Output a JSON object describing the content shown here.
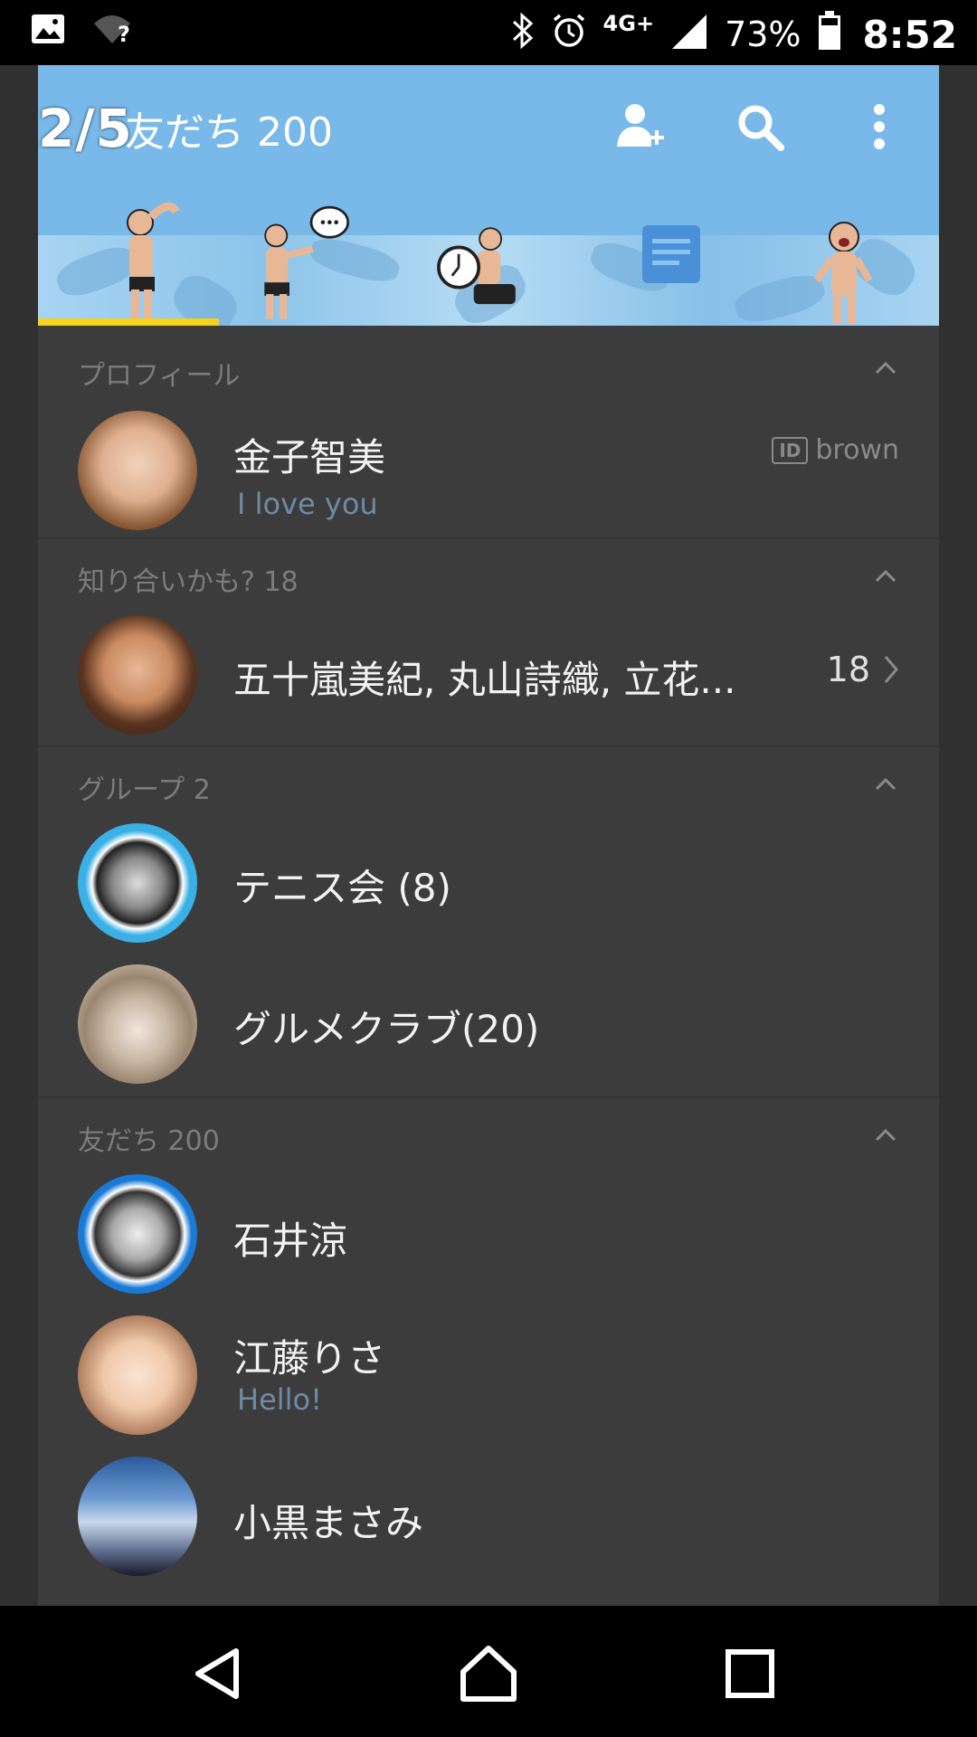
{
  "status_bar": {
    "wifi_label": "?",
    "network": "4G+",
    "battery": "73%",
    "time": "8:52"
  },
  "page_indicator": "2/5",
  "header": {
    "title": "友だち 200",
    "icons": [
      "add-friend-icon",
      "search-icon",
      "more-options-icon"
    ]
  },
  "tabs": [
    {
      "name": "friends-tab",
      "active": true
    },
    {
      "name": "chats-tab",
      "active": false
    },
    {
      "name": "timeline-tab",
      "active": false
    },
    {
      "name": "news-tab",
      "active": false
    },
    {
      "name": "more-tab",
      "active": false
    }
  ],
  "sections": {
    "profile": {
      "header": "プロフィール",
      "name": "金子智美",
      "status": "I love you",
      "id_badge": "ID",
      "id_value": "brown"
    },
    "suggestions": {
      "header": "知り合いかも? 18",
      "names": "五十嵐美紀, 丸山詩織, 立花...",
      "count": "18"
    },
    "groups": {
      "header": "グループ  2",
      "items": [
        {
          "name": "テニス会 (8)"
        },
        {
          "name": "グルメクラブ(20)"
        }
      ]
    },
    "friends": {
      "header": "友だち 200",
      "items": [
        {
          "name": "石井涼",
          "status": ""
        },
        {
          "name": "江藤りさ",
          "status": "Hello!"
        },
        {
          "name": "小黒まさみ",
          "status": ""
        }
      ]
    }
  },
  "colors": {
    "header_bg": "#78b9ea",
    "list_bg": "#3d3c3d",
    "active_tab_bar": "#f5d21e",
    "status_text": "#6f8aa4"
  }
}
